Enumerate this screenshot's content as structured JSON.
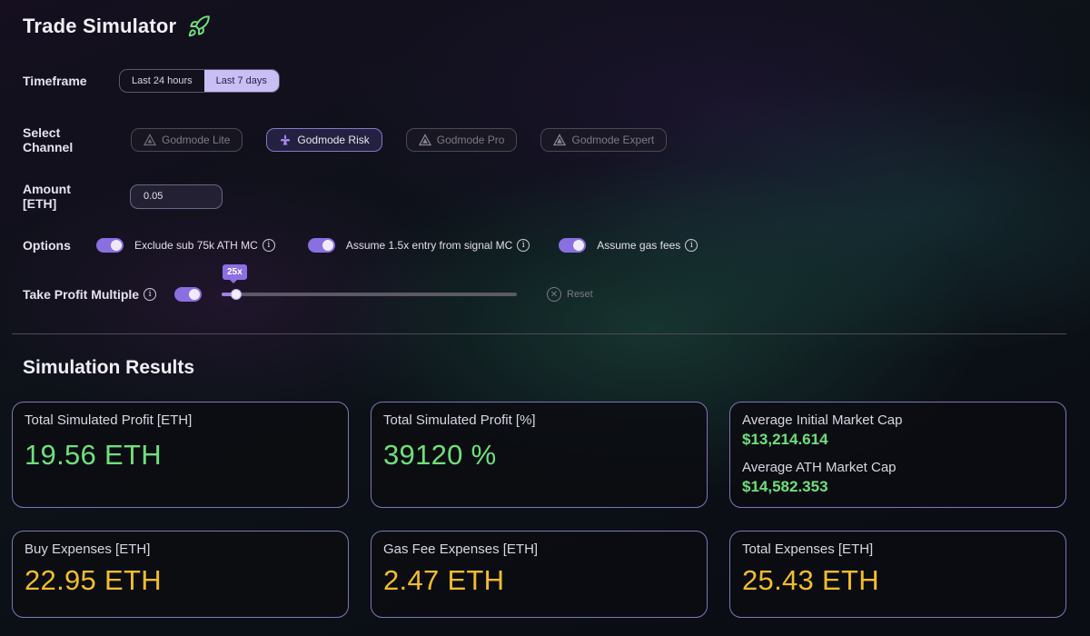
{
  "header": {
    "title": "Trade Simulator",
    "icon": "rocket-icon",
    "icon_color": "#6ee07b"
  },
  "timeframe": {
    "label": "Timeframe",
    "options": [
      "Last 24 hours",
      "Last 7 days"
    ],
    "selected": "Last 7 days"
  },
  "channel": {
    "label": "Select Channel",
    "options": [
      "Godmode Lite",
      "Godmode Risk",
      "Godmode Pro",
      "Godmode Expert"
    ],
    "selected": "Godmode Risk"
  },
  "amount": {
    "label": "Amount [ETH]",
    "value": "0.05"
  },
  "options": {
    "label": "Options",
    "items": [
      {
        "label": "Exclude sub 75k ATH MC",
        "enabled": true
      },
      {
        "label": "Assume 1.5x entry from signal MC",
        "enabled": true
      },
      {
        "label": "Assume gas fees",
        "enabled": true
      }
    ]
  },
  "take_profit": {
    "label": "Take Profit Multiple",
    "enabled": true,
    "slider_value_label": "25x",
    "slider_fraction": 0.05,
    "reset_label": "Reset"
  },
  "results": {
    "title": "Simulation Results",
    "cards": [
      {
        "label": "Total Simulated Profit [ETH]",
        "value": "19.56 ETH"
      },
      {
        "label": "Total Simulated Profit [%]",
        "value": "39120 %"
      },
      {
        "label": "Buy Expenses [ETH]",
        "value": "22.95 ETH"
      },
      {
        "label": "Gas Fee Expenses [ETH]",
        "value": "2.47 ETH"
      },
      {
        "label": "Total Expenses [ETH]",
        "value": "25.43 ETH"
      }
    ],
    "market_cap": {
      "initial_label": "Average Initial Market Cap",
      "initial_value": "$13,214.614",
      "ath_label": "Average ATH Market Cap",
      "ath_value": "$14,582.353"
    }
  },
  "colors": {
    "accent": "#8a6fe0",
    "positive": "#6ee07b",
    "expense": "#f2bd2b",
    "card_border": "#7e76b8"
  }
}
